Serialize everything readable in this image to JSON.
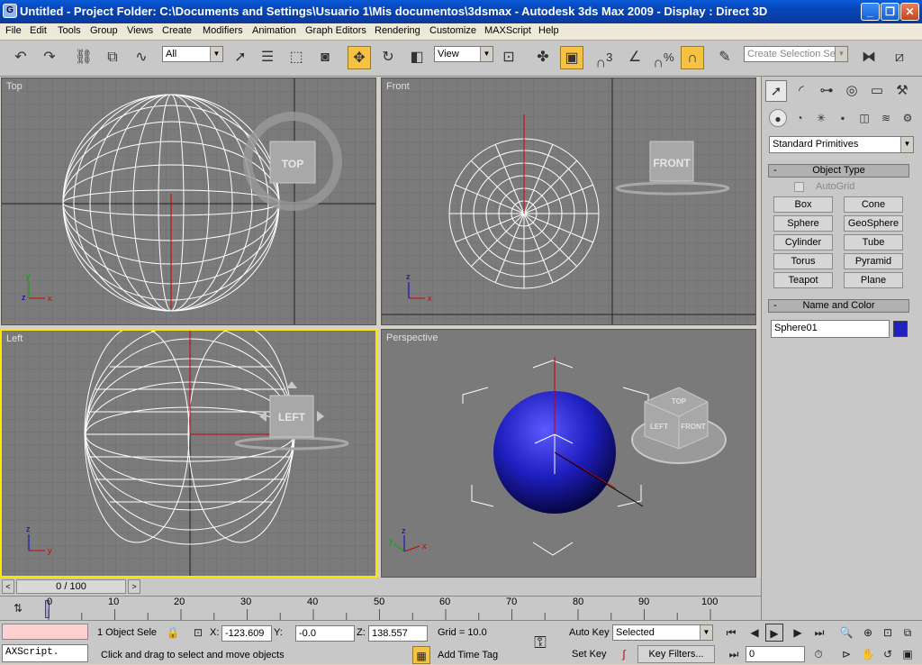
{
  "window": {
    "title": "Untitled     - Project Folder: C:\\Documents and Settings\\Usuario 1\\Mis documentos\\3dsmax     - Autodesk 3ds Max  2009         - Display : Direct 3D",
    "app_icon": "3ds-max-icon"
  },
  "menu": [
    "File",
    "Edit",
    "Tools",
    "Group",
    "Views",
    "Create",
    "Modifiers",
    "Animation",
    "Graph Editors",
    "Rendering",
    "Customize",
    "MAXScript",
    "Help"
  ],
  "toolbar": {
    "selection_filter": "All",
    "reference_coord": "View",
    "selection_set_placeholder": "Create Selection Set",
    "active_tool": "select-and-move",
    "snap_label": "3",
    "percent_snap_label": "%"
  },
  "viewports": {
    "top": {
      "label": "Top",
      "viewcube": "TOP"
    },
    "front": {
      "label": "Front",
      "viewcube": "FRONT"
    },
    "left": {
      "label": "Left",
      "viewcube": "LEFT"
    },
    "perspective": {
      "label": "Perspective",
      "viewcube_faces": [
        "TOP",
        "LEFT",
        "FRONT"
      ]
    },
    "axis": {
      "x": "x",
      "y": "y",
      "z": "z"
    },
    "sphere_color": "#1e1ebe",
    "active_border_color": "#ffe800"
  },
  "command_panel": {
    "category_dropdown": "Standard Primitives",
    "object_type": {
      "header": "Object Type",
      "autogrid": "AutoGrid",
      "buttons": [
        "Box",
        "Cone",
        "Sphere",
        "GeoSphere",
        "Cylinder",
        "Tube",
        "Torus",
        "Pyramid",
        "Teapot",
        "Plane"
      ]
    },
    "name_color": {
      "header": "Name and Color",
      "name": "Sphere01",
      "swatch": "#2222c0"
    }
  },
  "timeline": {
    "slider_label": "0 / 100",
    "ticks": [
      "0",
      "10",
      "20",
      "30",
      "40",
      "50",
      "60",
      "70",
      "80",
      "90",
      "100"
    ]
  },
  "status": {
    "maxscript_listener": "AXScript.",
    "selection_info": "1 Object Sele",
    "x_label": "X:",
    "x_value": "-123.609",
    "y_label": "Y:",
    "y_value": "-0.0",
    "z_label": "Z:",
    "z_value": "138.557",
    "grid": "Grid = 10.0",
    "prompt": "Click and drag to select and move objects",
    "add_time_tag": "Add Time Tag",
    "auto_key": "Auto Key",
    "set_key": "Set Key",
    "key_mode": "Selected",
    "key_filters": "Key Filters...",
    "frame": "0"
  }
}
